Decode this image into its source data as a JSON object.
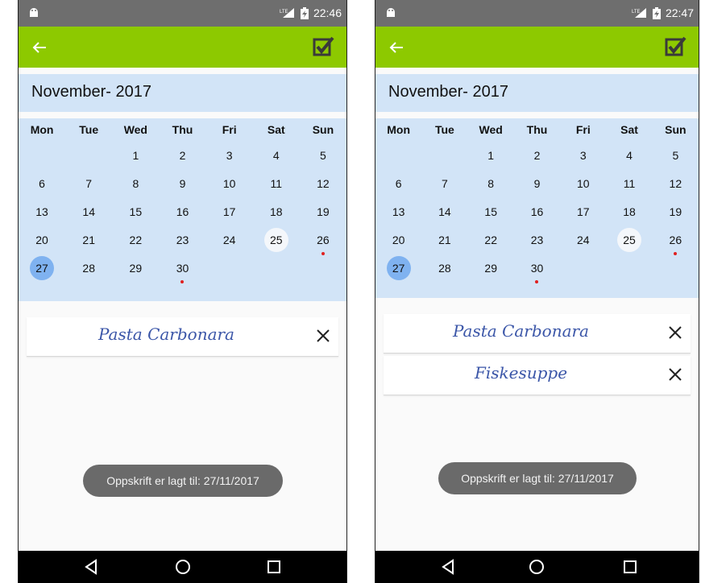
{
  "screens": [
    {
      "status": {
        "network_icon": "lte-signal-icon",
        "battery_icon": "battery-charging-icon",
        "time": "22:46"
      },
      "appbar": {
        "back_icon": "arrow-left-icon",
        "confirm_icon": "checkbox-checked-icon"
      },
      "calendar": {
        "month_title": "November- 2017",
        "weekdays": [
          "Mon",
          "Tue",
          "Wed",
          "Thu",
          "Fri",
          "Sat",
          "Sun"
        ],
        "today": "25",
        "selected": "27",
        "event_days": [
          "26",
          "30"
        ]
      },
      "recipes": [
        "Pasta Carbonara"
      ],
      "toast": "Oppskrift er lagt til: 27/11/2017"
    },
    {
      "status": {
        "network_icon": "lte-signal-icon",
        "battery_icon": "battery-charging-icon",
        "time": "22:47"
      },
      "appbar": {
        "back_icon": "arrow-left-icon",
        "confirm_icon": "checkbox-checked-icon"
      },
      "calendar": {
        "month_title": "November- 2017",
        "weekdays": [
          "Mon",
          "Tue",
          "Wed",
          "Thu",
          "Fri",
          "Sat",
          "Sun"
        ],
        "today": "25",
        "selected": "27",
        "event_days": [
          "26",
          "30"
        ]
      },
      "recipes": [
        "Pasta Carbonara",
        "Fiskesuppe"
      ],
      "toast": "Oppskrift er lagt til: 27/11/2017"
    }
  ],
  "weeks": [
    [
      "",
      "",
      "1",
      "2",
      "3",
      "4",
      "5"
    ],
    [
      "6",
      "7",
      "8",
      "9",
      "10",
      "11",
      "12"
    ],
    [
      "13",
      "14",
      "15",
      "16",
      "17",
      "18",
      "19"
    ],
    [
      "20",
      "21",
      "22",
      "23",
      "24",
      "25",
      "26"
    ],
    [
      "27",
      "28",
      "29",
      "30",
      "",
      "",
      ""
    ]
  ],
  "colors": {
    "appbar": "#8dc900",
    "calendar_bg": "#d2e4f7",
    "selected_day": "#7fb2f0",
    "event_dot": "#e02020",
    "recipe_text": "#3b56a8"
  }
}
